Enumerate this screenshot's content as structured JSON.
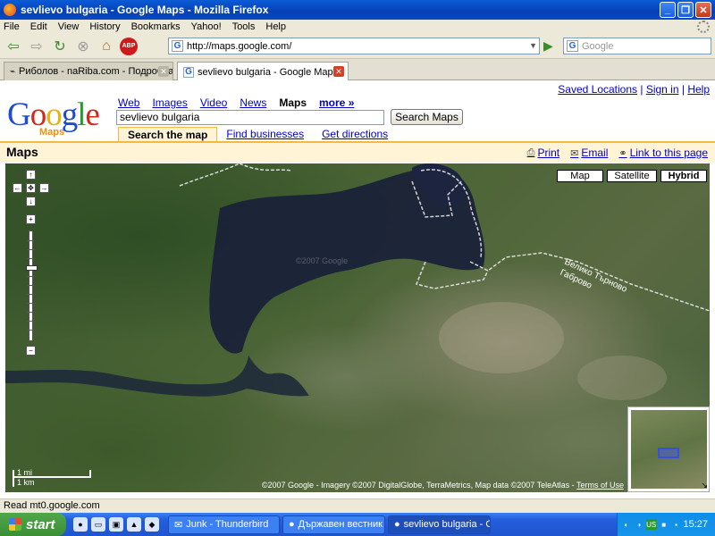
{
  "window": {
    "title": "sevlievo bulgaria - Google Maps - Mozilla Firefox"
  },
  "menu": [
    "File",
    "Edit",
    "View",
    "History",
    "Bookmarks",
    "Yahoo!",
    "Tools",
    "Help"
  ],
  "nav": {
    "url": "http://maps.google.com/",
    "search_placeholder": "Google"
  },
  "tabs": [
    {
      "label": "Риболов - naRiba.com - Подробна ка..."
    },
    {
      "label": "sevlievo bulgaria - Google Maps"
    }
  ],
  "gmaps": {
    "top_links": [
      "Saved Locations",
      "Sign in",
      "Help"
    ],
    "logo_text": "Google",
    "logo_sub": "Maps",
    "search_tabs": [
      "Web",
      "Images",
      "Video",
      "News",
      "Maps",
      "more »"
    ],
    "query": "sevlievo bulgaria",
    "search_button": "Search Maps",
    "subtabs": [
      "Search the map",
      "Find businesses",
      "Get directions"
    ],
    "maps_title": "Maps",
    "actions": [
      {
        "label": "Print",
        "icon": "printer-icon"
      },
      {
        "label": "Email",
        "icon": "envelope-icon"
      },
      {
        "label": "Link to this page",
        "icon": "chain-link-icon"
      }
    ],
    "map_types": [
      "Map",
      "Satellite",
      "Hybrid"
    ],
    "zoom_in": "+",
    "zoom_out": "−",
    "scale_mi": "1 mi",
    "scale_km": "1 km",
    "boundary_label_1": "Велико Търново",
    "boundary_label_2": "Габрово",
    "watermark": "©2007 Google",
    "copyright": "©2007 Google - Imagery ©2007 DigitalGlobe, TerraMetrics, Map data ©2007 TeleAtlas -",
    "terms": "Terms of Use",
    "overview_corner": "↘"
  },
  "status": "Read mt0.google.com",
  "taskbar": {
    "start": "start",
    "tasks": [
      "Junk - Thunderbird",
      "Държавен вестник -...",
      "sevlievo bulgaria - Go..."
    ],
    "time": "15:27",
    "tray_lang": "US"
  }
}
